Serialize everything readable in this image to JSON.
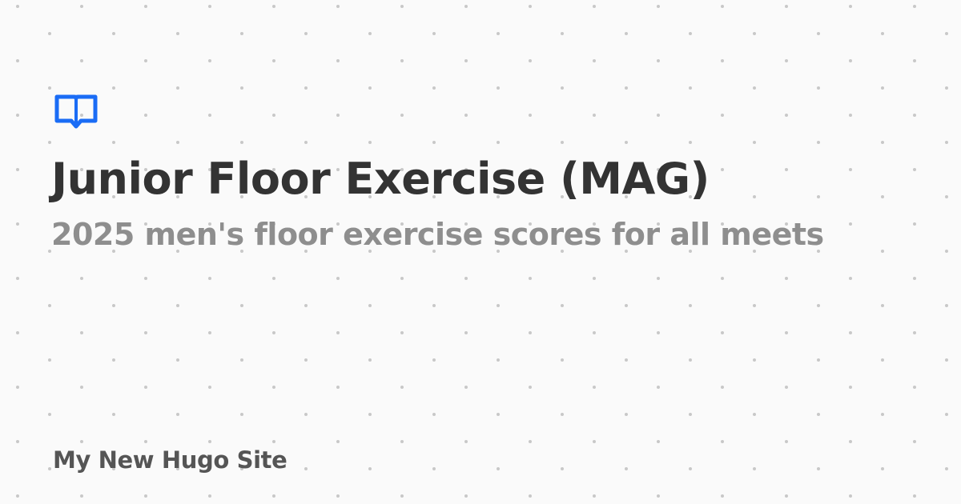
{
  "card": {
    "title": "Junior Floor Exercise (MAG)",
    "subtitle": "2025 men's floor exercise scores for all meets",
    "site_name": "My New Hugo Site",
    "logo_icon": "book-open-icon"
  },
  "colors": {
    "background": "#fafafa",
    "dots": "#c8c8c8",
    "accent": "#1a6cf5",
    "title": "#333333",
    "subtitle": "#8e8e8e",
    "site_name": "#555555"
  }
}
